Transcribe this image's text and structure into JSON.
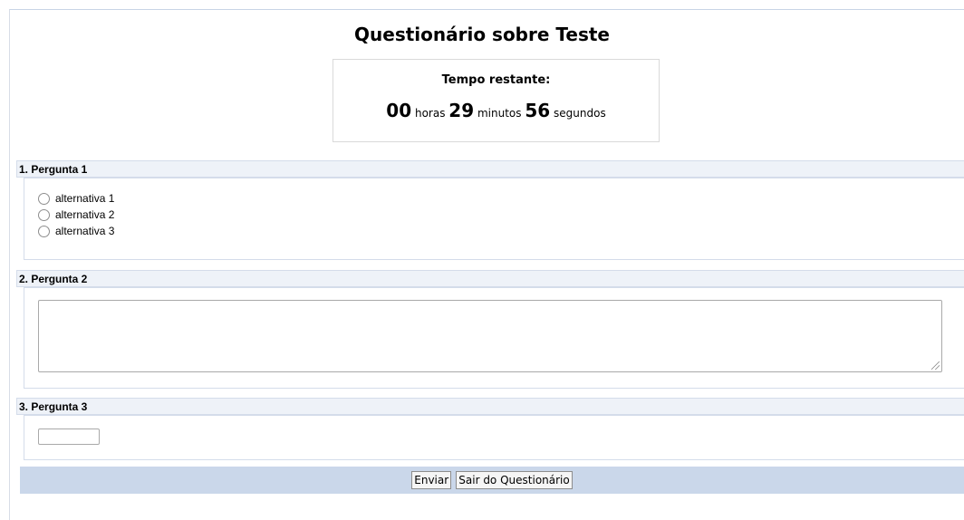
{
  "page": {
    "title": "Questionário sobre Teste"
  },
  "timer": {
    "label": "Tempo restante:",
    "hours": "00",
    "hours_unit": "horas",
    "minutes": "29",
    "minutes_unit": "minutos",
    "seconds": "56",
    "seconds_unit": "segundos"
  },
  "questions": [
    {
      "label": "1. Pergunta 1",
      "options": [
        "alternativa 1",
        "alternativa 2",
        "alternativa 3"
      ]
    },
    {
      "label": "2. Pergunta 2",
      "answer": ""
    },
    {
      "label": "3. Pergunta 3",
      "answer": ""
    }
  ],
  "actions": {
    "submit_label": "Enviar",
    "exit_label": "Sair do Questionário"
  }
}
